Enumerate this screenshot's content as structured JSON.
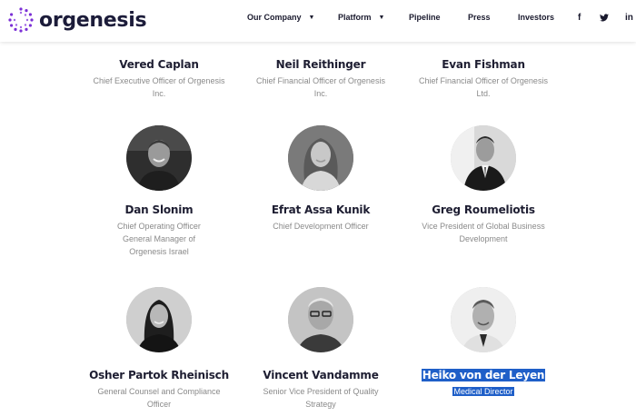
{
  "brand": {
    "name": "orgenesis",
    "color": "#7b2fd6"
  },
  "nav": {
    "items": [
      {
        "label": "Our Company",
        "has_dropdown": true
      },
      {
        "label": "Platform",
        "has_dropdown": true
      },
      {
        "label": "Pipeline",
        "has_dropdown": false
      },
      {
        "label": "Press",
        "has_dropdown": false
      },
      {
        "label": "Investors",
        "has_dropdown": false
      }
    ],
    "social": [
      {
        "label": "f",
        "icon": "facebook-icon"
      },
      {
        "label": "🐦",
        "icon": "twitter-icon"
      },
      {
        "label": "in",
        "icon": "linkedin-icon"
      }
    ]
  },
  "team": [
    {
      "name": "Vered Caplan",
      "title_lines": [
        "Chief Executive Officer of Orgenesis",
        "Inc."
      ],
      "has_photo": false
    },
    {
      "name": "Neil Reithinger",
      "title_lines": [
        "Chief Financial Officer of Orgenesis",
        "Inc."
      ],
      "has_photo": false
    },
    {
      "name": "Evan Fishman",
      "title_lines": [
        "Chief Financial Officer of Orgenesis",
        "Ltd."
      ],
      "has_photo": false
    },
    {
      "name": "Dan Slonim",
      "title_lines": [
        "Chief Operating Officer",
        "General Manager of",
        "Orgenesis Israel"
      ],
      "has_photo": true
    },
    {
      "name": "Efrat Assa Kunik",
      "title_lines": [
        "Chief Development Officer"
      ],
      "has_photo": true
    },
    {
      "name": "Greg Roumeliotis",
      "title_lines": [
        "Vice President of Global Business",
        "Development"
      ],
      "has_photo": true
    },
    {
      "name": "Osher Partok Rheinisch",
      "title_lines": [
        "General Counsel and Compliance",
        "Officer"
      ],
      "has_photo": true
    },
    {
      "name": "Vincent Vandamme",
      "title_lines": [
        "Senior Vice President of Quality",
        "Strategy"
      ],
      "has_photo": true
    },
    {
      "name": "Heiko von der Leyen",
      "title_lines": [
        "Medical Director"
      ],
      "has_photo": true,
      "selected": true
    }
  ],
  "colors": {
    "selection": "#1f5fc8",
    "name_text": "#1e1e32",
    "title_text": "#8a8a8a"
  }
}
